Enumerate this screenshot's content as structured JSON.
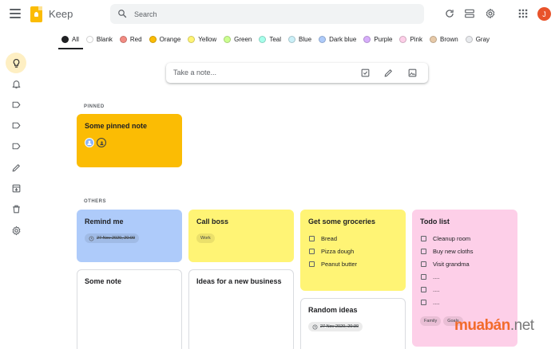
{
  "app": {
    "title": "Keep",
    "avatar_letter": "J"
  },
  "search": {
    "placeholder": "Search"
  },
  "filters": [
    {
      "label": "All",
      "color": "#202124"
    },
    {
      "label": "Blank",
      "color": "#ffffff"
    },
    {
      "label": "Red",
      "color": "#f28b82"
    },
    {
      "label": "Orange",
      "color": "#fbbc04"
    },
    {
      "label": "Yellow",
      "color": "#fff475"
    },
    {
      "label": "Green",
      "color": "#ccff90"
    },
    {
      "label": "Teal",
      "color": "#a7ffeb"
    },
    {
      "label": "Blue",
      "color": "#cbf0f8"
    },
    {
      "label": "Dark blue",
      "color": "#aecbfa"
    },
    {
      "label": "Purple",
      "color": "#d7aefb"
    },
    {
      "label": "Pink",
      "color": "#fdcfe8"
    },
    {
      "label": "Brown",
      "color": "#e6c9a8"
    },
    {
      "label": "Gray",
      "color": "#e8eaed"
    }
  ],
  "take_note": {
    "placeholder": "Take a note..."
  },
  "sections": {
    "pinned": "PINNED",
    "others": "OTHERS"
  },
  "notes": {
    "pinned": {
      "title": "Some pinned note"
    },
    "remind": {
      "title": "Remind me",
      "reminder": "27 Nov 2020, 20:00"
    },
    "call_boss": {
      "title": "Call boss",
      "label": "Work"
    },
    "groceries": {
      "title": "Get some groceries",
      "items": [
        "Bread",
        "Pizza dough",
        "Peanut butter"
      ]
    },
    "todo": {
      "title": "Todo list",
      "items": [
        "Cleanup room",
        "Buy new cloths",
        "Visit grandma",
        "....",
        "....",
        "...."
      ],
      "labels": [
        "Family",
        "Goals"
      ]
    },
    "some_note": {
      "title": "Some note"
    },
    "ideas": {
      "title": "Ideas for a new business"
    },
    "random": {
      "title": "Random ideas",
      "reminder": "27 Nov 2020, 20:30"
    }
  },
  "watermark": {
    "part1": "muabán",
    "part2": ".net"
  }
}
